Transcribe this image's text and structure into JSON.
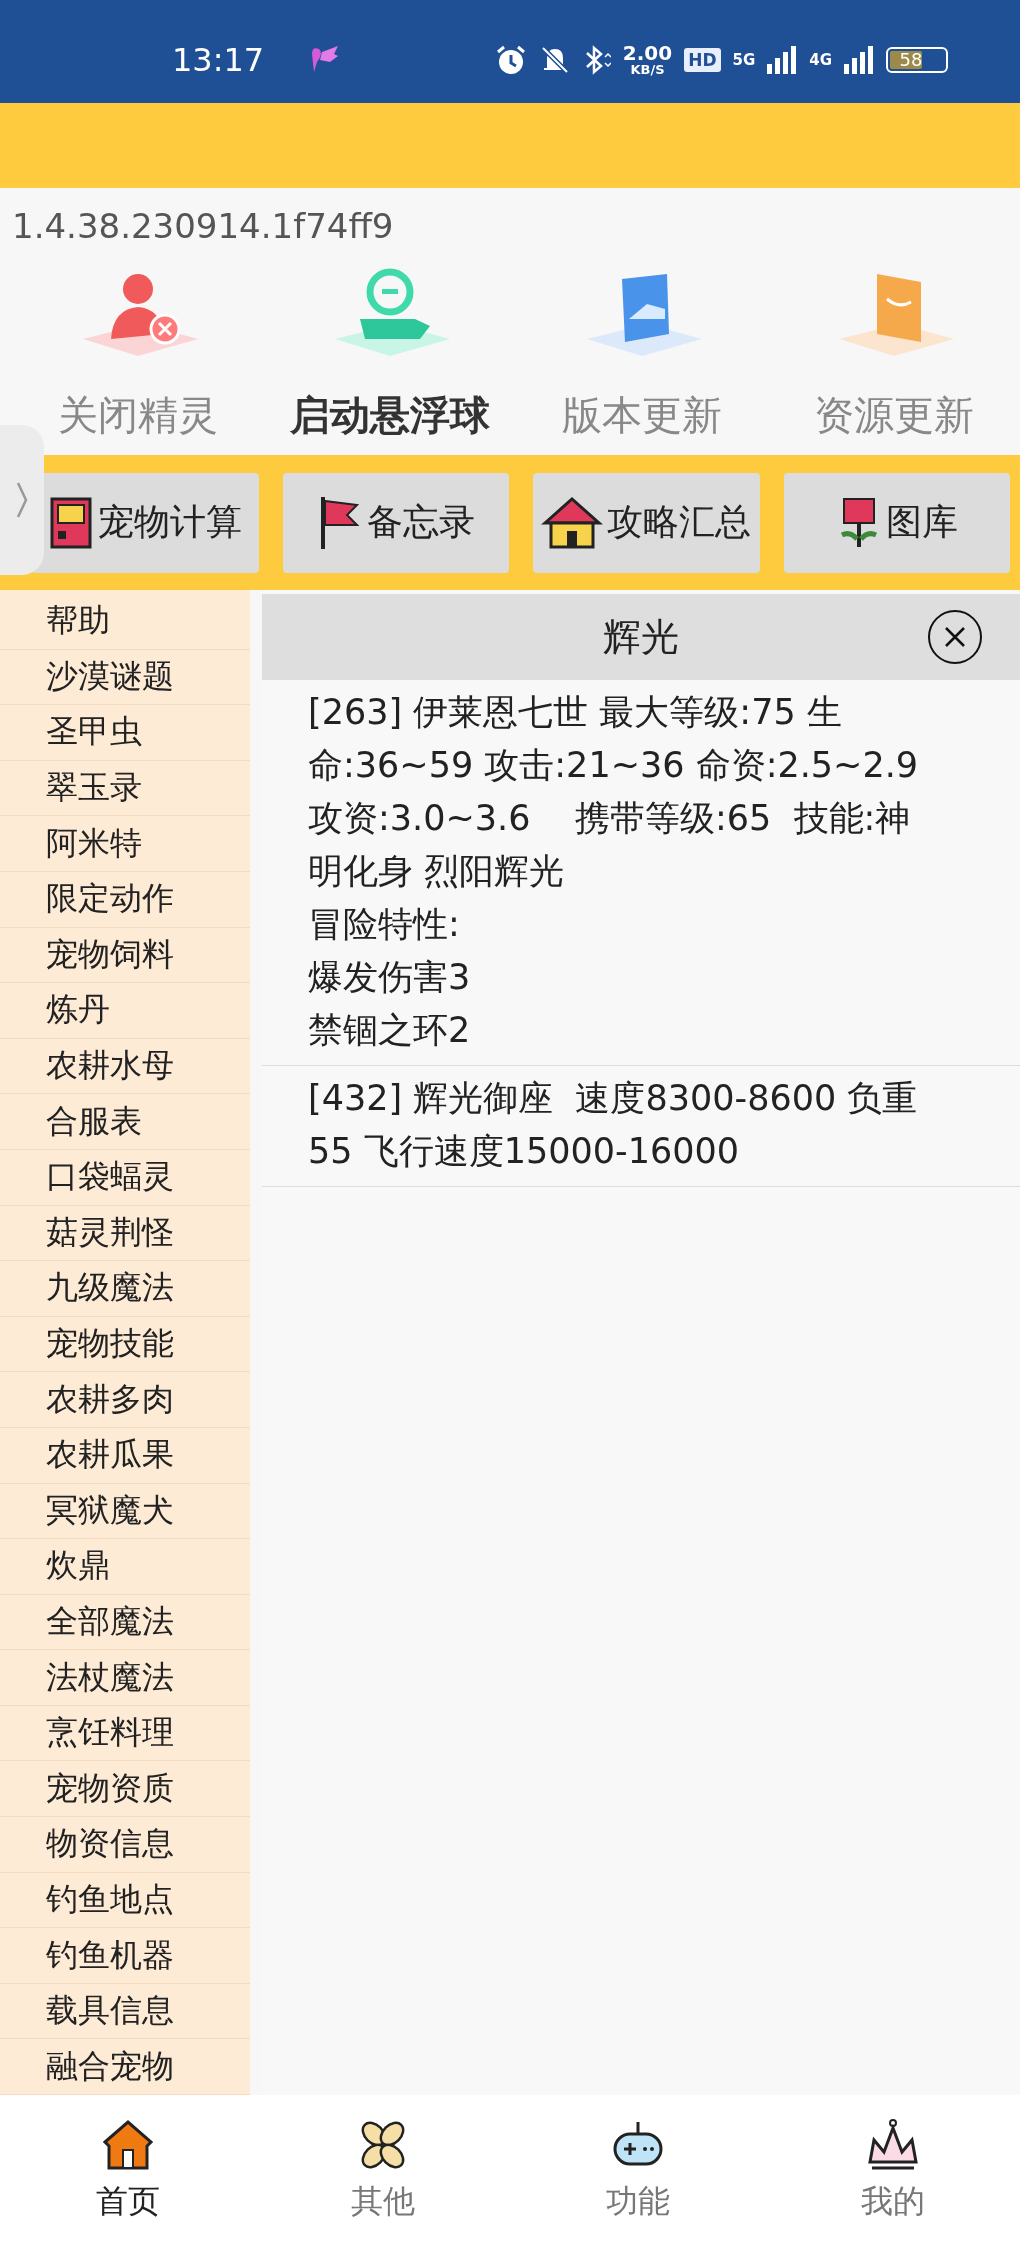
{
  "status_bar": {
    "time": "13:17",
    "net_speed": "2.00",
    "net_unit": "KB/S",
    "hd": "HD",
    "signal_1": "5G",
    "signal_2": "4G",
    "battery": "58"
  },
  "version": "1.4.38.230914.1f74ff9",
  "quick_actions": [
    {
      "label": "关闭精灵",
      "kind": "close",
      "active": false
    },
    {
      "label": "启动悬浮球",
      "kind": "float",
      "active": true
    },
    {
      "label": "版本更新",
      "kind": "folder",
      "active": false
    },
    {
      "label": "资源更新",
      "kind": "box",
      "active": false
    }
  ],
  "toolbar": [
    {
      "label": "宠物计算",
      "kind": "gameboy"
    },
    {
      "label": "备忘录",
      "kind": "flag"
    },
    {
      "label": "攻略汇总",
      "kind": "house"
    },
    {
      "label": "图库",
      "kind": "flower"
    }
  ],
  "sidebar": {
    "items": [
      "帮助",
      "沙漠谜题",
      "圣甲虫",
      "翠玉录",
      "阿米特",
      "限定动作",
      "宠物饲料",
      "炼丹",
      "农耕水母",
      "合服表",
      "口袋蝠灵",
      "菇灵荆怪",
      "九级魔法",
      "宠物技能",
      "农耕多肉",
      "农耕瓜果",
      "冥狱魔犬",
      "炊鼎",
      "全部魔法",
      "法杖魔法",
      "烹饪料理",
      "宠物资质",
      "物资信息",
      "钓鱼地点",
      "钓鱼机器",
      "载具信息",
      "融合宠物"
    ]
  },
  "search": {
    "value": "辉光"
  },
  "results": [
    {
      "paragraphs": [
        "[263] 伊莱恩七世 最大等级:75 生",
        "命:36~59 攻击:21~36 命资:2.5~2.9",
        "攻资:3.0~3.6    携带等级:65  技能:神",
        "明化身 烈阳辉光",
        "冒险特性:",
        "爆发伤害3",
        "禁锢之环2"
      ]
    },
    {
      "paragraphs": [
        "[432] 辉光御座  速度8300-8600 负重",
        "55 飞行速度15000-16000"
      ]
    }
  ],
  "nav": [
    {
      "label": "首页",
      "kind": "home",
      "selected": true
    },
    {
      "label": "其他",
      "kind": "pinwheel",
      "selected": false
    },
    {
      "label": "功能",
      "kind": "gamepad",
      "selected": false
    },
    {
      "label": "我的",
      "kind": "crown",
      "selected": false
    }
  ]
}
